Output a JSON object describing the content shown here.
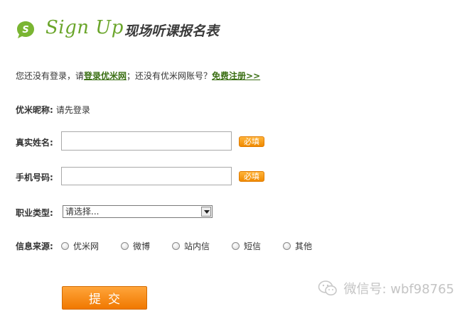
{
  "header": {
    "logo_letter": "S",
    "brand": "Sign Up",
    "title": "现场听课报名表"
  },
  "login_prompt": {
    "prefix": "您还没有登录，请",
    "login_link": "登录优米网",
    "middle": "；还没有优米网账号？",
    "register_link": "免费注册>>"
  },
  "nickname": {
    "label": "优米昵称:",
    "value": "请先登录"
  },
  "real_name": {
    "label": "真实姓名:",
    "value": "",
    "required_badge": "必填"
  },
  "phone": {
    "label": "手机号码:",
    "value": "",
    "required_badge": "必填"
  },
  "occupation": {
    "label": "职业类型:",
    "selected": "请选择..."
  },
  "source": {
    "label": "信息来源:",
    "options": [
      "优米网",
      "微博",
      "站内信",
      "短信",
      "其他"
    ]
  },
  "submit": {
    "label": "提交"
  },
  "watermark": {
    "text": "微信号: wbf98765"
  },
  "colors": {
    "brand_green": "#6aa52a",
    "accent_orange": "#f08a00",
    "link_green": "#3b6f14"
  }
}
